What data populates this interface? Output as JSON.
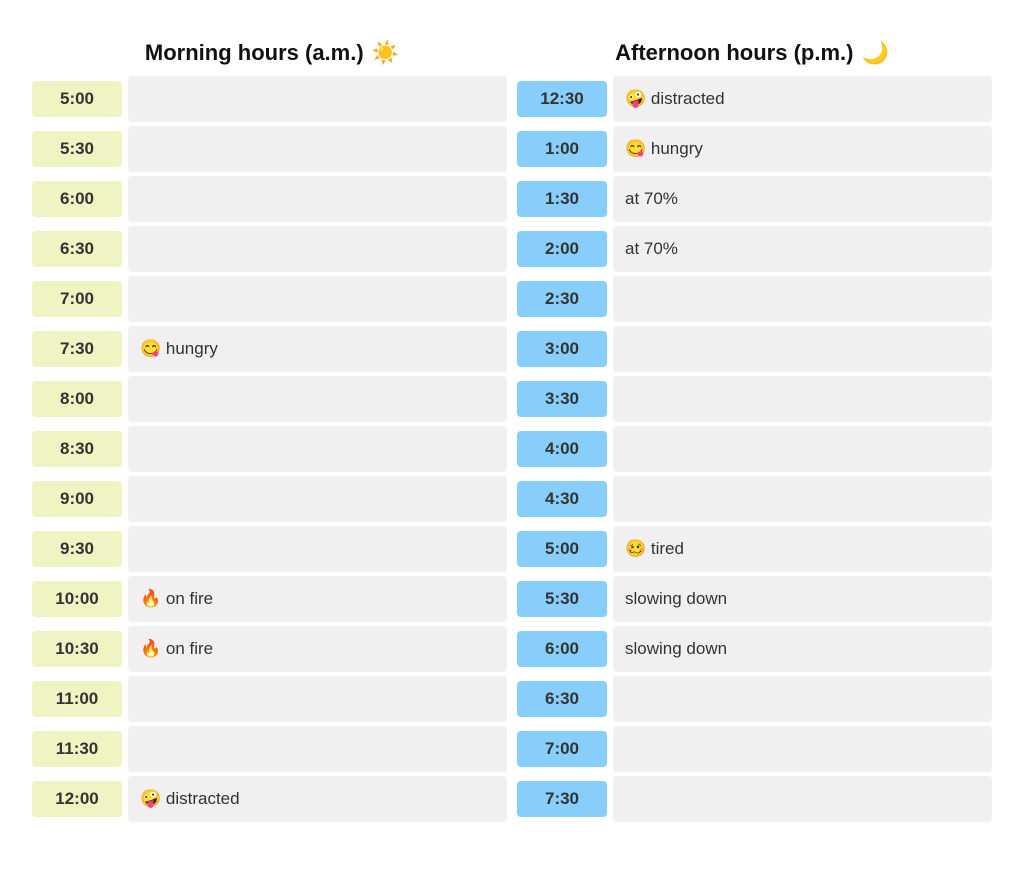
{
  "header": {
    "am_label": "Morning hours (a.m.)",
    "am_icon": "☀️",
    "pm_label": "Afternoon hours (p.m.)",
    "pm_icon": "🌙"
  },
  "am_rows": [
    {
      "time": "5:00",
      "note": ""
    },
    {
      "time": "5:30",
      "note": ""
    },
    {
      "time": "6:00",
      "note": ""
    },
    {
      "time": "6:30",
      "note": ""
    },
    {
      "time": "7:00",
      "note": ""
    },
    {
      "time": "7:30",
      "note": "😋 hungry"
    },
    {
      "time": "8:00",
      "note": ""
    },
    {
      "time": "8:30",
      "note": ""
    },
    {
      "time": "9:00",
      "note": ""
    },
    {
      "time": "9:30",
      "note": ""
    },
    {
      "time": "10:00",
      "note": "🔥 on fire"
    },
    {
      "time": "10:30",
      "note": "🔥 on fire"
    },
    {
      "time": "11:00",
      "note": ""
    },
    {
      "time": "11:30",
      "note": ""
    },
    {
      "time": "12:00",
      "note": "🤪 distracted"
    }
  ],
  "pm_rows": [
    {
      "time": "12:30",
      "note": "🤪 distracted"
    },
    {
      "time": "1:00",
      "note": "😋 hungry"
    },
    {
      "time": "1:30",
      "note": "at 70%"
    },
    {
      "time": "2:00",
      "note": "at 70%"
    },
    {
      "time": "2:30",
      "note": ""
    },
    {
      "time": "3:00",
      "note": ""
    },
    {
      "time": "3:30",
      "note": ""
    },
    {
      "time": "4:00",
      "note": ""
    },
    {
      "time": "4:30",
      "note": ""
    },
    {
      "time": "5:00",
      "note": "🥴 tired"
    },
    {
      "time": "5:30",
      "note": "slowing down"
    },
    {
      "time": "6:00",
      "note": "slowing down"
    },
    {
      "time": "6:30",
      "note": ""
    },
    {
      "time": "7:00",
      "note": ""
    },
    {
      "time": "7:30",
      "note": ""
    }
  ]
}
